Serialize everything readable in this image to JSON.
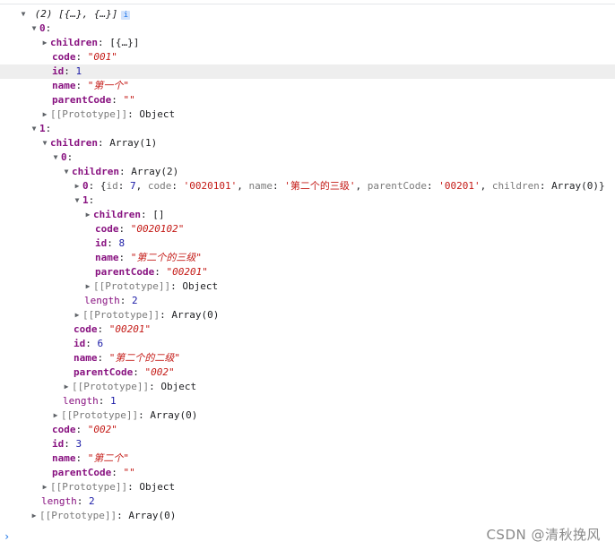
{
  "console": {
    "summary": {
      "count": "(2)",
      "preview": "[{…}, {…}]",
      "info": "i"
    },
    "item0": {
      "index": "0",
      "children_key": "children",
      "children_val": "[{…}]",
      "code_key": "code",
      "code_val": "\"001\"",
      "id_key": "id",
      "id_val": "1",
      "name_key": "name",
      "name_val": "\"第一个\"",
      "parentCode_key": "parentCode",
      "parentCode_val": "\"\"",
      "proto_label": "[[Prototype]]",
      "proto_val": "Object"
    },
    "item1": {
      "index": "1",
      "children_key": "children",
      "children_val": "Array(1)",
      "child0": {
        "index": "0",
        "children_key": "children",
        "children_val": "Array(2)",
        "grand0": {
          "index": "0",
          "open": "{",
          "id_key": "id",
          "id_val": "7",
          "code_key": "code",
          "code_val": "'0020101'",
          "name_key": "name",
          "name_val": "'第二个的三级'",
          "parentCode_key": "parentCode",
          "parentCode_val": "'00201'",
          "children_key": "children",
          "children_val": "Array(0)",
          "close": "}"
        },
        "grand1": {
          "index": "1",
          "children_key": "children",
          "children_val": "[]",
          "code_key": "code",
          "code_val": "\"0020102\"",
          "id_key": "id",
          "id_val": "8",
          "name_key": "name",
          "name_val": "\"第二个的三级\"",
          "parentCode_key": "parentCode",
          "parentCode_val": "\"00201\"",
          "proto_label": "[[Prototype]]",
          "proto_val": "Object"
        },
        "length_key": "length",
        "length_val": "2",
        "arr_proto_label": "[[Prototype]]",
        "arr_proto_val": "Array(0)",
        "code_key": "code",
        "code_val": "\"00201\"",
        "id_key": "id",
        "id_val": "6",
        "name_key": "name",
        "name_val": "\"第二个的二级\"",
        "parentCode_key": "parentCode",
        "parentCode_val": "\"002\"",
        "proto_label": "[[Prototype]]",
        "proto_val": "Object"
      },
      "length_key": "length",
      "length_val": "1",
      "arr_proto_label": "[[Prototype]]",
      "arr_proto_val": "Array(0)",
      "code_key": "code",
      "code_val": "\"002\"",
      "id_key": "id",
      "id_val": "3",
      "name_key": "name",
      "name_val": "\"第二个\"",
      "parentCode_key": "parentCode",
      "parentCode_val": "\"\"",
      "proto_label": "[[Prototype]]",
      "proto_val": "Object"
    },
    "length_key": "length",
    "length_val": "2",
    "arr_proto_label": "[[Prototype]]",
    "arr_proto_val": "Array(0)",
    "prompt": "›"
  },
  "watermark": "CSDN @清秋挽风",
  "icons": {
    "expanded": "triangle-down-icon",
    "collapsed": "triangle-right-icon"
  }
}
